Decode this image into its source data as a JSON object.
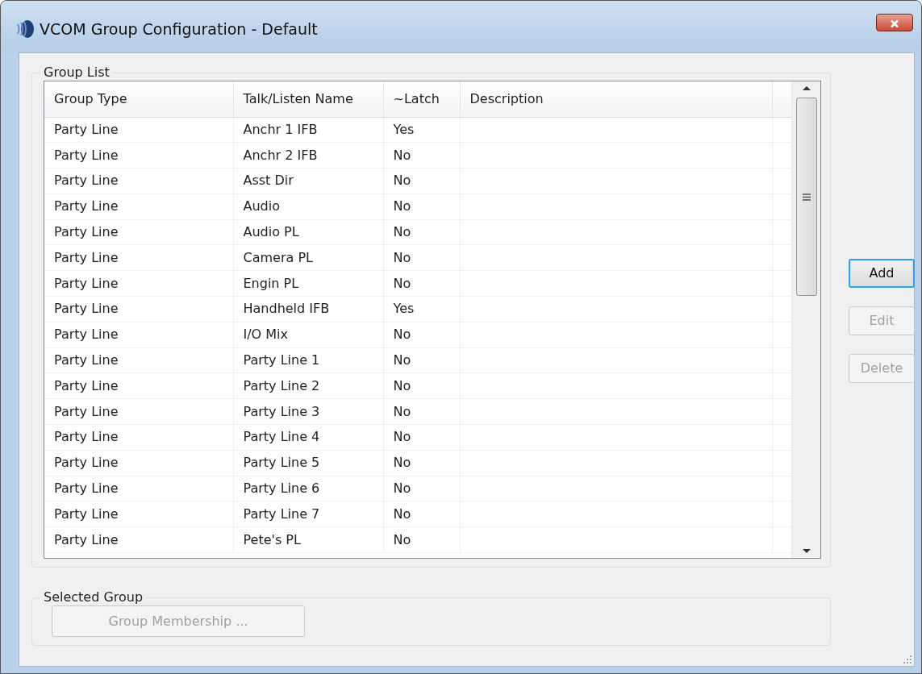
{
  "window": {
    "title": "VCOM Group Configuration - Default"
  },
  "group_list": {
    "label": "Group List",
    "columns": [
      "Group Type",
      "Talk/Listen Name",
      "~Latch",
      "Description"
    ],
    "rows": [
      {
        "group_type": "Party Line",
        "name": "Anchr 1 IFB",
        "latch": "Yes"
      },
      {
        "group_type": "Party Line",
        "name": "Anchr 2 IFB",
        "latch": "No"
      },
      {
        "group_type": "Party Line",
        "name": "Asst Dir",
        "latch": "No"
      },
      {
        "group_type": "Party Line",
        "name": "Audio",
        "latch": "No"
      },
      {
        "group_type": "Party Line",
        "name": "Audio PL",
        "latch": "No"
      },
      {
        "group_type": "Party Line",
        "name": "Camera PL",
        "latch": "No"
      },
      {
        "group_type": "Party Line",
        "name": "Engin PL",
        "latch": "No"
      },
      {
        "group_type": "Party Line",
        "name": "Handheld IFB",
        "latch": "Yes"
      },
      {
        "group_type": "Party Line",
        "name": "I/O Mix",
        "latch": "No"
      },
      {
        "group_type": "Party Line",
        "name": "Party Line 1",
        "latch": "No"
      },
      {
        "group_type": "Party Line",
        "name": "Party Line 2",
        "latch": "No"
      },
      {
        "group_type": "Party Line",
        "name": "Party Line 3",
        "latch": "No"
      },
      {
        "group_type": "Party Line",
        "name": "Party Line 4",
        "latch": "No"
      },
      {
        "group_type": "Party Line",
        "name": "Party Line 5",
        "latch": "No"
      },
      {
        "group_type": "Party Line",
        "name": "Party Line 6",
        "latch": "No"
      },
      {
        "group_type": "Party Line",
        "name": "Party Line 7",
        "latch": "No"
      },
      {
        "group_type": "Party Line",
        "name": "Pete's PL",
        "latch": "No"
      }
    ]
  },
  "buttons": [
    {
      "label": "Add",
      "disabled": false,
      "focused": true
    },
    {
      "label": "Edit",
      "disabled": true,
      "focused": false
    },
    {
      "label": "Delete",
      "disabled": true,
      "focused": false
    }
  ],
  "selected_group": {
    "label": "Selected Group",
    "button": {
      "label": "Group Membership ...",
      "disabled": true
    }
  }
}
